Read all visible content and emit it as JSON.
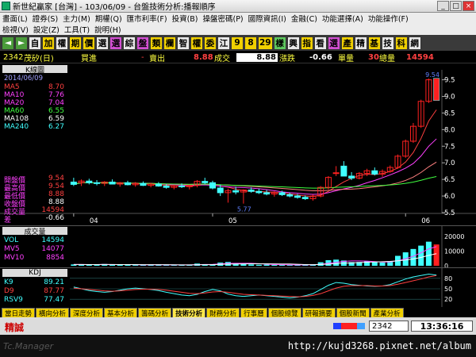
{
  "window": {
    "title": "新世紀贏家 [台灣] - 103/06/09 - 台盤技術分析:播報順序",
    "buttons": [
      "_",
      "□",
      "×"
    ]
  },
  "menu": {
    "row1": [
      "畫面(L)",
      "證券(S)",
      "主力(M)",
      "期權(Q)",
      "匯市利率(F)",
      "投資(B)",
      "操盤密碼(P)",
      "國際資訊(I)",
      "金融(C)",
      "功能選擇(A)",
      "功能操作(F)"
    ],
    "row2": [
      "檢視(V)",
      "設定(Z)",
      "工具(T)",
      "說明(H)"
    ]
  },
  "toolbar": {
    "nav": [
      "◄",
      "►"
    ],
    "buttons": [
      {
        "label": "自",
        "bg": "#e8e8e8"
      },
      {
        "label": "加",
        "bg": "#f0d000"
      },
      {
        "label": "權",
        "bg": "#e8e8e8"
      },
      {
        "label": "期",
        "bg": "#f0d000"
      },
      {
        "label": "價",
        "bg": "#f0d000"
      },
      {
        "label": "選",
        "bg": "#e8e8e8"
      },
      {
        "label": "選",
        "bg": "#d24fd2"
      },
      {
        "label": "綜",
        "bg": "#e8e8e8"
      },
      {
        "label": "盤",
        "bg": "#d24fd2"
      },
      {
        "label": "類",
        "bg": "#f0d000"
      },
      {
        "label": "欄",
        "bg": "#f0d000"
      },
      {
        "label": "智",
        "bg": "#e8e8e8"
      },
      {
        "label": "權",
        "bg": "#f0d000"
      },
      {
        "label": "委",
        "bg": "#f0d000"
      },
      {
        "label": "江",
        "bg": "#e8e8e8"
      },
      {
        "label": "9",
        "bg": "#f0d000"
      },
      {
        "label": "8",
        "bg": "#f0d000"
      },
      {
        "label": "29",
        "bg": "#f0d000"
      },
      {
        "label": "樣",
        "bg": "#5fc95f"
      },
      {
        "label": "興",
        "bg": "#e8e8e8"
      },
      {
        "label": "指",
        "bg": "#f0d000"
      },
      {
        "label": "看",
        "bg": "#e8e8e8"
      },
      {
        "label": "選",
        "bg": "#d24fd2"
      },
      {
        "label": "產",
        "bg": "#f0d000"
      },
      {
        "label": "精",
        "bg": "#e8e8e8"
      },
      {
        "label": "基",
        "bg": "#f0d000"
      },
      {
        "label": "技",
        "bg": "#e8e8e8"
      },
      {
        "label": "科",
        "bg": "#f0d000"
      },
      {
        "label": "網",
        "bg": "#e8e8e8"
      }
    ]
  },
  "header": {
    "code": "2342",
    "name": "茂矽(日)",
    "buy_label": "買進",
    "buy_value": "-",
    "sell_label": "賣出",
    "trade_value": "8.88",
    "trade_label": "成交",
    "change_box": "8.88",
    "change_label": "漲跌",
    "change_value": "-0.66",
    "vol_label": "單量",
    "total_value": "30",
    "total_label": "總量",
    "total_qty": "14594"
  },
  "main": {
    "legend_title": "K線圖",
    "legend_date": "2014/06/09",
    "ma": [
      {
        "name": "MA5",
        "value": "8.70",
        "color": "#ff4040"
      },
      {
        "name": "MA10",
        "value": "7.76",
        "color": "#ff40ff"
      },
      {
        "name": "MA20",
        "value": "7.04",
        "color": "#ff40ff"
      },
      {
        "name": "MA60",
        "value": "6.55",
        "color": "#40ff40"
      },
      {
        "name": "MA108",
        "value": "6.59",
        "color": "#ffffff"
      },
      {
        "name": "MA240",
        "value": "6.27",
        "color": "#40ffff"
      }
    ],
    "info": [
      {
        "label": "開盤價",
        "value": "9.54",
        "lcolor": "#ff40ff",
        "vcolor": "#ff4040"
      },
      {
        "label": "最高價",
        "value": "9.54",
        "lcolor": "#ff40ff",
        "vcolor": "#ff4040"
      },
      {
        "label": "最低價",
        "value": "8.88",
        "lcolor": "#ff40ff",
        "vcolor": "#ff4040"
      },
      {
        "label": "收盤價",
        "value": "8.88",
        "lcolor": "#ff40ff",
        "vcolor": "#ffffff"
      },
      {
        "label": "成交量",
        "value": "14594",
        "lcolor": "#ff40ff",
        "vcolor": "#ff4040"
      },
      {
        "label": "差",
        "value": "-0.66",
        "lcolor": "#ff40ff",
        "vcolor": "#ffffff"
      }
    ],
    "high_marker": "9.54",
    "low_marker": "5.77"
  },
  "chart_data": [
    {
      "type": "candlestick",
      "x_labels": [
        "04",
        "05",
        "06"
      ],
      "ylim": [
        5.5,
        9.8
      ],
      "y_ticks": [
        "9.5",
        "9.0",
        "8.5",
        "8.0",
        "7.5",
        "7.0",
        "6.5",
        "6.0",
        "5.5"
      ],
      "candles": [
        {
          "o": 6.42,
          "h": 6.55,
          "l": 6.3,
          "c": 6.35
        },
        {
          "o": 6.4,
          "h": 6.5,
          "l": 6.3,
          "c": 6.45
        },
        {
          "o": 6.45,
          "h": 6.52,
          "l": 6.35,
          "c": 6.4
        },
        {
          "o": 6.4,
          "h": 6.48,
          "l": 6.32,
          "c": 6.38
        },
        {
          "o": 6.38,
          "h": 6.45,
          "l": 6.3,
          "c": 6.42
        },
        {
          "o": 6.42,
          "h": 6.5,
          "l": 6.35,
          "c": 6.36
        },
        {
          "o": 6.36,
          "h": 6.42,
          "l": 6.28,
          "c": 6.4
        },
        {
          "o": 6.4,
          "h": 6.46,
          "l": 6.32,
          "c": 6.34
        },
        {
          "o": 6.34,
          "h": 6.42,
          "l": 6.28,
          "c": 6.38
        },
        {
          "o": 6.38,
          "h": 6.44,
          "l": 6.3,
          "c": 6.32
        },
        {
          "o": 6.32,
          "h": 6.4,
          "l": 6.26,
          "c": 6.36
        },
        {
          "o": 6.36,
          "h": 6.42,
          "l": 6.28,
          "c": 6.3
        },
        {
          "o": 6.3,
          "h": 6.36,
          "l": 6.22,
          "c": 6.26
        },
        {
          "o": 6.26,
          "h": 6.34,
          "l": 6.2,
          "c": 6.3
        },
        {
          "o": 6.3,
          "h": 6.38,
          "l": 6.24,
          "c": 6.28
        },
        {
          "o": 6.28,
          "h": 6.34,
          "l": 6.2,
          "c": 6.32
        },
        {
          "o": 6.32,
          "h": 6.48,
          "l": 6.26,
          "c": 6.44
        },
        {
          "o": 6.44,
          "h": 6.55,
          "l": 6.36,
          "c": 6.4
        },
        {
          "o": 6.4,
          "h": 6.46,
          "l": 6.2,
          "c": 6.24
        },
        {
          "o": 6.24,
          "h": 6.34,
          "l": 6.0,
          "c": 6.1
        },
        {
          "o": 6.1,
          "h": 6.22,
          "l": 5.8,
          "c": 6.16
        },
        {
          "o": 6.16,
          "h": 6.28,
          "l": 6.05,
          "c": 6.12
        },
        {
          "o": 6.12,
          "h": 6.2,
          "l": 5.77,
          "c": 6.18
        },
        {
          "o": 6.18,
          "h": 6.26,
          "l": 6.1,
          "c": 6.14
        },
        {
          "o": 6.14,
          "h": 6.22,
          "l": 6.06,
          "c": 6.1
        },
        {
          "o": 6.1,
          "h": 6.18,
          "l": 6.02,
          "c": 6.06
        },
        {
          "o": 6.06,
          "h": 6.14,
          "l": 5.98,
          "c": 6.1
        },
        {
          "o": 6.1,
          "h": 6.16,
          "l": 6.0,
          "c": 6.04
        },
        {
          "o": 6.04,
          "h": 6.1,
          "l": 5.96,
          "c": 6.0
        },
        {
          "o": 6.0,
          "h": 6.06,
          "l": 5.92,
          "c": 5.96
        },
        {
          "o": 5.96,
          "h": 6.02,
          "l": 5.88,
          "c": 5.92
        },
        {
          "o": 5.92,
          "h": 6.04,
          "l": 5.86,
          "c": 6.0
        },
        {
          "o": 6.0,
          "h": 6.3,
          "l": 5.96,
          "c": 6.26
        },
        {
          "o": 6.26,
          "h": 6.6,
          "l": 6.2,
          "c": 6.56
        },
        {
          "o": 6.7,
          "h": 6.9,
          "l": 6.6,
          "c": 6.7
        },
        {
          "o": 6.9,
          "h": 7.05,
          "l": 6.7,
          "c": 6.6
        },
        {
          "o": 6.6,
          "h": 6.72,
          "l": 6.48,
          "c": 6.54
        },
        {
          "o": 6.54,
          "h": 6.72,
          "l": 6.5,
          "c": 6.68
        },
        {
          "o": 6.68,
          "h": 6.82,
          "l": 6.6,
          "c": 6.76
        },
        {
          "o": 6.76,
          "h": 6.86,
          "l": 6.62,
          "c": 6.66
        },
        {
          "o": 6.66,
          "h": 6.8,
          "l": 6.58,
          "c": 6.74
        },
        {
          "o": 6.74,
          "h": 6.92,
          "l": 6.7,
          "c": 6.86
        },
        {
          "o": 6.86,
          "h": 7.25,
          "l": 6.82,
          "c": 7.2
        },
        {
          "o": 7.2,
          "h": 7.7,
          "l": 7.15,
          "c": 7.65
        },
        {
          "o": 7.65,
          "h": 8.2,
          "l": 7.6,
          "c": 8.1
        },
        {
          "o": 8.1,
          "h": 8.9,
          "l": 8.05,
          "c": 8.85
        },
        {
          "o": 8.85,
          "h": 9.54,
          "l": 8.8,
          "c": 9.5
        },
        {
          "o": 9.54,
          "h": 9.54,
          "l": 8.88,
          "c": 8.88
        }
      ]
    },
    {
      "type": "bar",
      "title": "成交量",
      "series_labels": [
        {
          "name": "VOL",
          "value": "14594",
          "color": "#40ffff"
        },
        {
          "name": "MV5",
          "value": "14077",
          "color": "#ff40ff"
        },
        {
          "name": "MV10",
          "value": "8854",
          "color": "#ff40ff"
        }
      ],
      "y_ticks": [
        "20000",
        "10000",
        "0"
      ],
      "ylim": [
        0,
        25000
      ],
      "values": [
        900,
        800,
        700,
        900,
        1200,
        600,
        700,
        800,
        500,
        600,
        700,
        800,
        500,
        400,
        600,
        700,
        1500,
        1100,
        900,
        2200,
        2600,
        1700,
        1200,
        900,
        700,
        800,
        600,
        700,
        500,
        600,
        700,
        900,
        2400,
        3800,
        4200,
        3600,
        2500,
        2600,
        3000,
        2400,
        2200,
        3100,
        6800,
        9200,
        11500,
        13800,
        16500,
        14594
      ]
    },
    {
      "type": "line",
      "title": "KDJ",
      "series_labels": [
        {
          "name": "K9",
          "value": "89.21",
          "color": "#40ffff"
        },
        {
          "name": "D9",
          "value": "87.77",
          "color": "#ff4040"
        },
        {
          "name": "RSV9",
          "value": "77.47",
          "color": "#40ffff"
        }
      ],
      "y_ticks": [
        "80",
        "50",
        "20"
      ],
      "ylim": [
        0,
        100
      ],
      "series": [
        {
          "name": "K9",
          "color": "#40ffff",
          "values": [
            55,
            50,
            45,
            42,
            40,
            42,
            46,
            50,
            52,
            50,
            48,
            45,
            40,
            36,
            32,
            30,
            34,
            42,
            48,
            44,
            35,
            30,
            28,
            30,
            32,
            30,
            28,
            26,
            24,
            26,
            30,
            36,
            48,
            60,
            68,
            66,
            62,
            60,
            58,
            57,
            58,
            62,
            70,
            78,
            84,
            88,
            92,
            89.21
          ]
        },
        {
          "name": "D9",
          "color": "#ff4040",
          "values": [
            52,
            50,
            48,
            46,
            44,
            43,
            44,
            46,
            48,
            49,
            49,
            48,
            46,
            43,
            40,
            37,
            36,
            38,
            41,
            42,
            40,
            37,
            34,
            33,
            32,
            31,
            30,
            29,
            28,
            27,
            28,
            31,
            36,
            44,
            52,
            57,
            59,
            59,
            59,
            58,
            58,
            59,
            63,
            68,
            73,
            78,
            84,
            87.77
          ]
        }
      ]
    }
  ],
  "tabs": [
    "當日走勢",
    "橫向分析",
    "深度分析",
    "基本分析",
    "籌碼分析",
    "技術分析",
    "財務分析",
    "行事曆",
    "個股總覽",
    "研報摘要",
    "個股新聞",
    "產業分析"
  ],
  "active_tab": "技術分析",
  "status": {
    "left_label": "精誠",
    "code": "2342",
    "time": "13:36:16"
  },
  "watermark": {
    "left": "Tc.Manager",
    "right": "http://kujd3268.pixnet.net/album"
  },
  "colors": {
    "up": "#ff2020",
    "down": "#40ffff",
    "ma5": "#ff4040",
    "ma10": "#ff40ff",
    "ma20": "#ff40ff",
    "ma60": "#40ff40"
  }
}
